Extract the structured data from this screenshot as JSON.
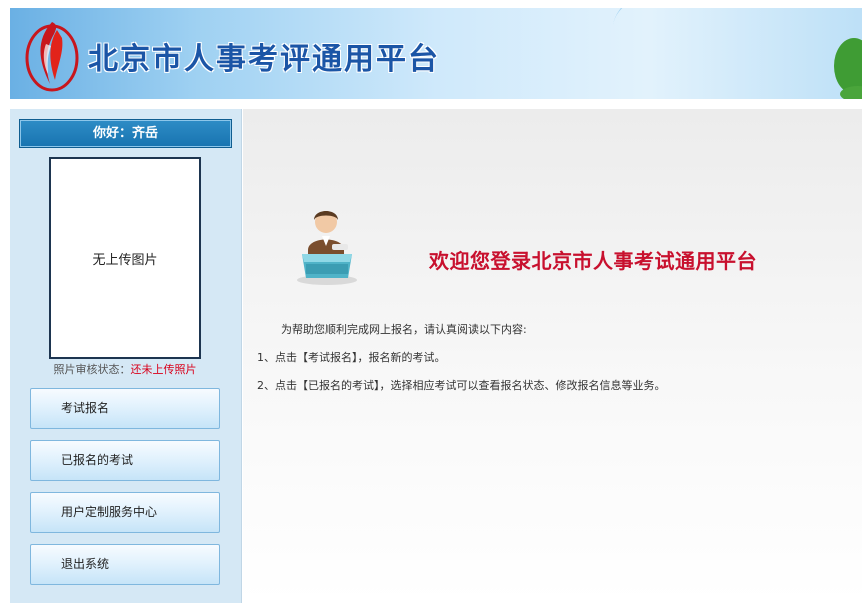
{
  "header": {
    "title": "北京市人事考评通用平台"
  },
  "sidebar": {
    "greeting": "你好：齐岳",
    "photo_placeholder": "无上传图片",
    "photo_status_label": "照片审核状态：",
    "photo_status_value": "还未上传照片",
    "items": [
      {
        "label": "考试报名"
      },
      {
        "label": "已报名的考试"
      },
      {
        "label": "用户定制服务中心"
      },
      {
        "label": "退出系统"
      }
    ]
  },
  "main": {
    "welcome": "欢迎您登录北京市人事考试通用平台",
    "intro": "为帮助您顺利完成网上报名，请认真阅读以下内容:",
    "steps": [
      "1、点击【考试报名】，报名新的考试。",
      "2、点击【已报名的考试】，选择相应考试可以查看报名状态、修改报名信息等业务。"
    ]
  },
  "colors": {
    "title_blue": "#1b55a6",
    "welcome_red": "#c8102e",
    "status_red": "#d9001b",
    "sidebar_bg": "#d5e8f5"
  }
}
